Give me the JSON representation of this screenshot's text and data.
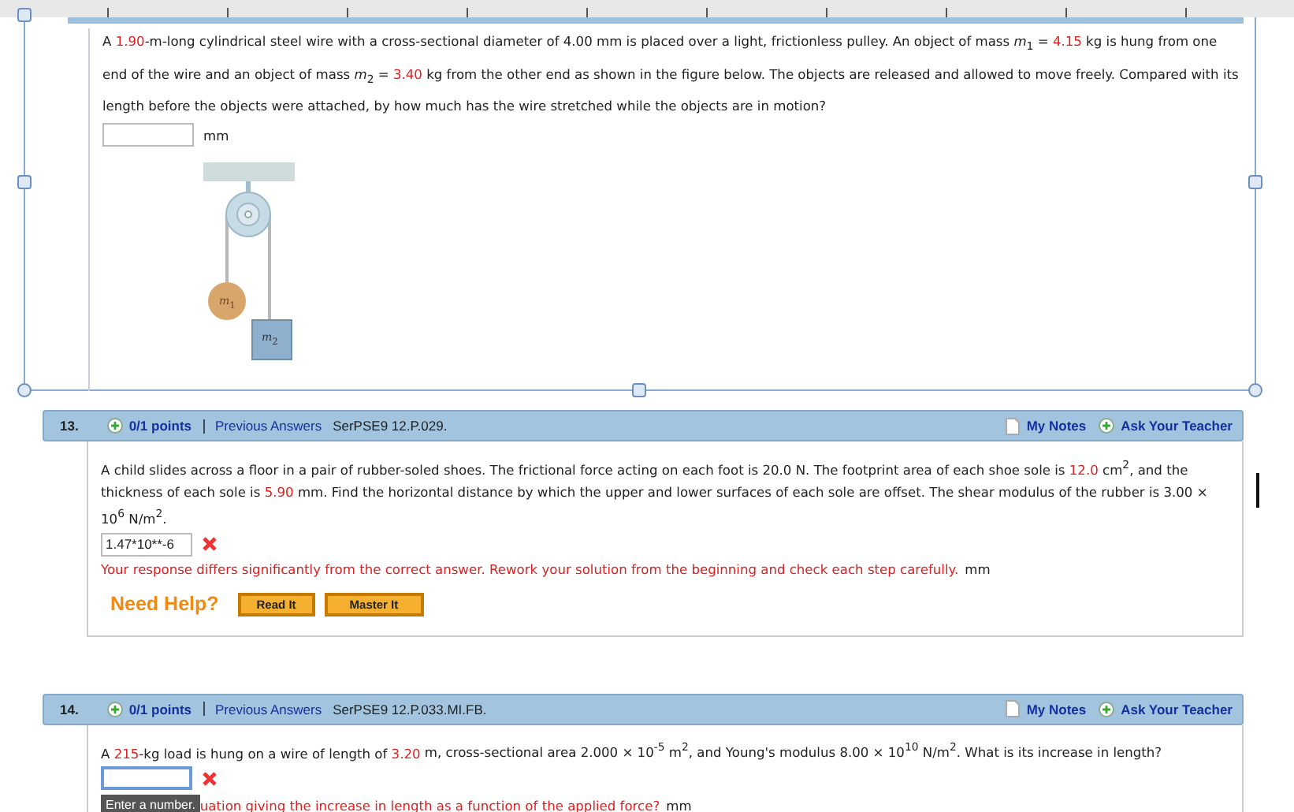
{
  "editor_frame": {
    "question_text": [
      {
        "kind": "plain",
        "text": "A "
      },
      {
        "kind": "value",
        "text": "1.90"
      },
      {
        "kind": "plain",
        "text": "-m-long cylindrical steel wire with a cross-sectional diameter of 4.00 mm is placed over a light, frictionless pulley. An object of mass *m*$_{1}$ = "
      },
      {
        "kind": "value",
        "text": "4.15"
      },
      {
        "kind": "plain",
        "text": " kg is hung from one end of the wire and an object of mass *m*$_{2}$ = "
      },
      {
        "kind": "value",
        "text": "3.40"
      },
      {
        "kind": "plain",
        "text": " kg from the other end as shown in the figure below. The objects are released and allowed to move freely. Compared with its length before the objects were attached, by how much has the wire stretched while the objects are in motion?"
      }
    ],
    "answer": {
      "unit": "mm"
    },
    "figure": {
      "labels": [
        "*m*$_{1}$",
        "*m*$_{2}$"
      ]
    }
  },
  "questions": [
    {
      "number": "13.",
      "points": "0/1 points",
      "link": "Previous Answers",
      "code": "SerPSE9 12.P.029.",
      "notes": "My Notes",
      "ask": "Ask Your Teacher",
      "text": [
        {
          "kind": "plain",
          "text": "A child slides across a floor in a pair of rubber-soled shoes. The frictional force acting on each foot is 20.0 N. The footprint area of each shoe sole is "
        },
        {
          "kind": "value",
          "text": "12.0"
        },
        {
          "kind": "plain",
          "text": " cm$^{2}$, and the thickness of each sole is "
        },
        {
          "kind": "value",
          "text": "5.90"
        },
        {
          "kind": "plain",
          "text": " mm. Find the horizontal distance by which the upper and lower surfaces of each sole are offset. The shear modulus of the rubber is 3.00 × 10$^{6}$ N/m$^{2}$."
        }
      ],
      "answer": {
        "value": "1.47*10**-6",
        "incorrect": true,
        "focused": false
      },
      "feedback": {
        "text": "Your response differs significantly from the correct answer. Rework your solution from the beginning and check each step carefully.",
        "unit": "mm"
      },
      "help": {
        "label": "Need Help?",
        "buttons": [
          "Read It",
          "Master It"
        ]
      }
    },
    {
      "number": "14.",
      "points": "0/1 points",
      "link": "Previous Answers",
      "code": "SerPSE9 12.P.033.MI.FB.",
      "notes": "My Notes",
      "ask": "Ask Your Teacher",
      "text": [
        {
          "kind": "plain",
          "text": "A "
        },
        {
          "kind": "value",
          "text": "215"
        },
        {
          "kind": "plain",
          "text": "-kg load is hung on a wire of length of "
        },
        {
          "kind": "value",
          "text": "3.20"
        },
        {
          "kind": "plain",
          "text": " m, cross-sectional area 2.000 × 10$^{-5}$ m$^{2}$, and Young's modulus 8.00 × 10$^{10}$ N/m$^{2}$. What is its increase in length?"
        }
      ],
      "answer": {
        "incorrect": true,
        "focused": true,
        "tooltip": "Enter a number."
      },
      "feedback": {
        "text": "uation giving the increase in length as a function of the applied force?",
        "unit": "mm"
      }
    }
  ]
}
